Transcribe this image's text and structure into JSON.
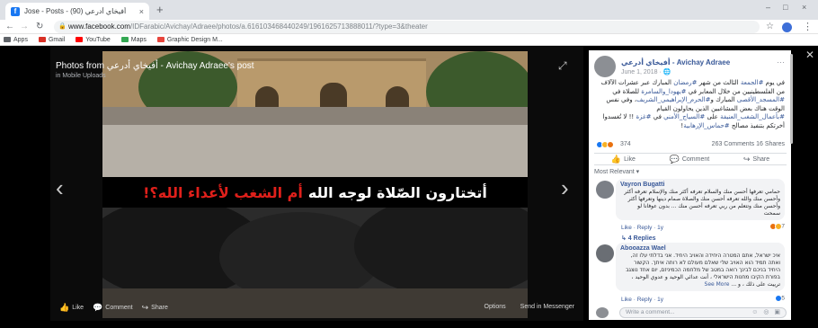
{
  "browser": {
    "tab_title": "Jose - Posts - أفيخاي أدرعي (90)",
    "tab_close": "×",
    "new_tab": "+",
    "window_controls": [
      "–",
      "□",
      "×"
    ],
    "url_host": "www.facebook.com",
    "url_path": "/IDFarabic/Avichay/Adraee/photos/a.616103468440249/1961625713888011/?type=3&theater",
    "bookmarks": [
      {
        "label": "Apps",
        "color": "#5f6368"
      },
      {
        "label": "Gmail",
        "color": "#d93025"
      },
      {
        "label": "YouTube",
        "color": "#ff0000"
      },
      {
        "label": "Maps",
        "color": "#34a853"
      },
      {
        "label": "Graphic Design M...",
        "color": "#e8453c"
      }
    ]
  },
  "viewer": {
    "title": "Photos from أفيخاي أدرعي - Avichay Adraee's post",
    "subtitle": "in Mobile Uploads",
    "banner_white": "أتختارون الصّلاة لوجه الله",
    "banner_red": "أم الشغب لأعداء الله؟!",
    "bottom_actions": [
      {
        "icon": "like-icon",
        "glyph": "👍",
        "label": "Like"
      },
      {
        "icon": "comment-icon",
        "glyph": "💬",
        "label": "Comment"
      },
      {
        "icon": "share-icon",
        "glyph": "↪",
        "label": "Share"
      }
    ],
    "bottom_right": [
      "Options",
      "Send in Messenger"
    ]
  },
  "post": {
    "author": "أفيخاي أدرعي - Avichay Adraee",
    "date": "June 1, 2018 · 🌐",
    "text_1": "في يوم",
    "hashtag_1": "#الجمعة",
    "text_2": "الثالث من شهر",
    "hashtag_2": "#رمضان",
    "text_3": "المبارك عبر عشرات الآلاف من الفلسطينيين من خلال المعابر في",
    "hashtag_3": "#يهودا_والسامرة",
    "text_4": "للصلاة في",
    "hashtag_4": "#المسجد_الأقصى",
    "text_5": "المبارك و",
    "hashtag_5": "#الحرم_الإبراهيمي_الشريف",
    "text_6": "، وفي نفس الوقت هناك بعض المشاغبين الذين يحاولون القيام",
    "hashtag_6": "#بأعمال_الشغب_العنيفة",
    "text_7": "على",
    "hashtag_7": "#السياج_الأمني",
    "text_8": "في",
    "hashtag_8": "#غزة",
    "text_9": "!! لا تُغسدوا أخرتكم بتنفيذ مصالح",
    "hashtag_9": "#حماس_الإرهابية",
    "text_10": "!",
    "reaction_count": "374",
    "comments_shares": "263 Comments  16 Shares",
    "actions": [
      {
        "icon": "like-icon",
        "glyph": "👍",
        "label": "Like"
      },
      {
        "icon": "comment-icon",
        "glyph": "💬",
        "label": "Comment"
      },
      {
        "icon": "share-icon",
        "glyph": "↪",
        "label": "Share"
      }
    ],
    "sort_label": "Most Relevant ▾"
  },
  "comments": [
    {
      "author": "Vayron Bugatti",
      "text": "حمامي تعرفها أحسن منك والسلام تعرفه أكثر منك والإسلام تعرفه أكثر وأحسن منك والله تعرفه أحسن منك والصلاة صمام دينها وتعرفها أكثر وأحسن منك وتتعلم من ربي تعرفه أحسن منك ... بدون عوفانا لو سمحت",
      "reaction_count": "7",
      "links": "Like · Reply · 1y",
      "replies": "↳ 4 Replies"
    },
    {
      "author": "Abooazza Wael",
      "text": "איכ ישראל, אתם המטרה היחידה והאויב היחיד. אני בדלתי עלו זה, ואתה תמיד הוא האויב שלי שאלם מעולם לא רותה איתך. הקשור היחיד בניכם לבינך רואה במטב של מלחמה הכמיניזם, יום אחד נוצגב בפורת הקיבו מחנות הישראלי ، أنت عدائي الوحيد و عدوي الوحيد ، ترييت على ذلك ، و ...",
      "see_more": "See More",
      "reaction_count": "5",
      "links": "Like · Reply · 1y"
    }
  ],
  "write_placeholder": "Write a comment...",
  "write_tools": "☺ ◎ ▣"
}
